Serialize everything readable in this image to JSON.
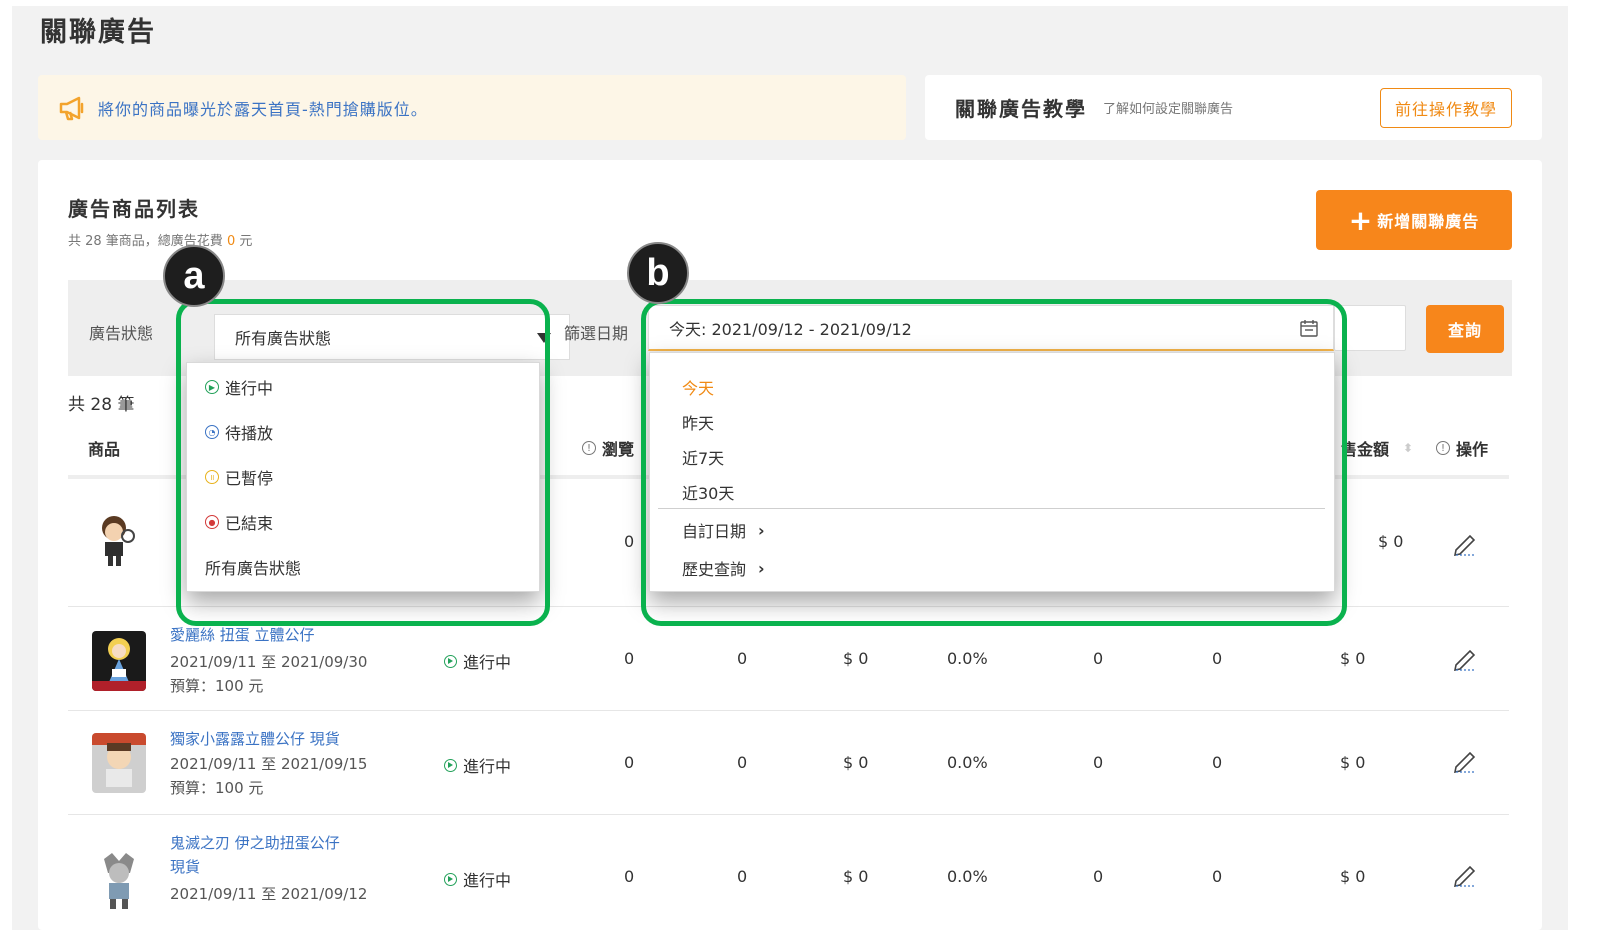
{
  "page": {
    "title": "關聯廣告"
  },
  "notice": {
    "text": "將你的商品曝光於露天首頁-熱門搶購版位。",
    "icon": "megaphone-icon"
  },
  "tutorial": {
    "title": "關聯廣告教學",
    "subtitle": "了解如何設定關聯廣告",
    "button": "前往操作教學"
  },
  "list": {
    "title": "廣告商品列表",
    "summary_prefix": "共 28 筆商品，總廣告花費 ",
    "summary_amount": "0",
    "summary_suffix": " 元",
    "add_button": "新增關聯廣告"
  },
  "filters": {
    "status_label": "廣告狀態",
    "status_value": "所有廣告狀態",
    "date_label": "篩選日期",
    "date_value": "今天:  2021/09/12 - 2021/09/12",
    "query_button": "查詢"
  },
  "count": "共 28 筆",
  "table": {
    "headers": {
      "product": "商品",
      "views": "瀏覽",
      "amount": "售金額",
      "ops": "操作"
    },
    "rows": [
      {
        "views": "0",
        "amount": "$ 0"
      },
      {
        "name": "愛麗絲 扭蛋 立體公仔",
        "date": "2021/09/11 至 2021/09/30",
        "budget": "預算：100 元",
        "status": "進行中",
        "c1": "0",
        "c2": "0",
        "c3": "$ 0",
        "c4": "0.0%",
        "c5": "0",
        "c6": "0",
        "c7": "$ 0"
      },
      {
        "name": "獨家小露露立體公仔 現貨",
        "date": "2021/09/11 至 2021/09/15",
        "budget": "預算：100 元",
        "status": "進行中",
        "c1": "0",
        "c2": "0",
        "c3": "$ 0",
        "c4": "0.0%",
        "c5": "0",
        "c6": "0",
        "c7": "$ 0"
      },
      {
        "name_line1": "鬼滅之刃 伊之助扭蛋公仔",
        "name_line2": "現貨",
        "date": "2021/09/11 至 2021/09/12",
        "status": "進行中",
        "c1": "0",
        "c2": "0",
        "c3": "$ 0",
        "c4": "0.0%",
        "c5": "0",
        "c6": "0",
        "c7": "$ 0"
      }
    ]
  },
  "status_dropdown": {
    "options": [
      "進行中",
      "待播放",
      "已暫停",
      "已結束",
      "所有廣告狀態"
    ]
  },
  "date_dropdown": {
    "options": [
      "今天",
      "昨天",
      "近7天",
      "近30天"
    ],
    "custom": "自訂日期",
    "history": "歷史查詢"
  },
  "annotations": {
    "a": "a",
    "b": "b"
  },
  "colors": {
    "accent": "#f7861b",
    "highlight": "#0ab24e",
    "link": "#3b73c4",
    "running": "#23a15a"
  }
}
